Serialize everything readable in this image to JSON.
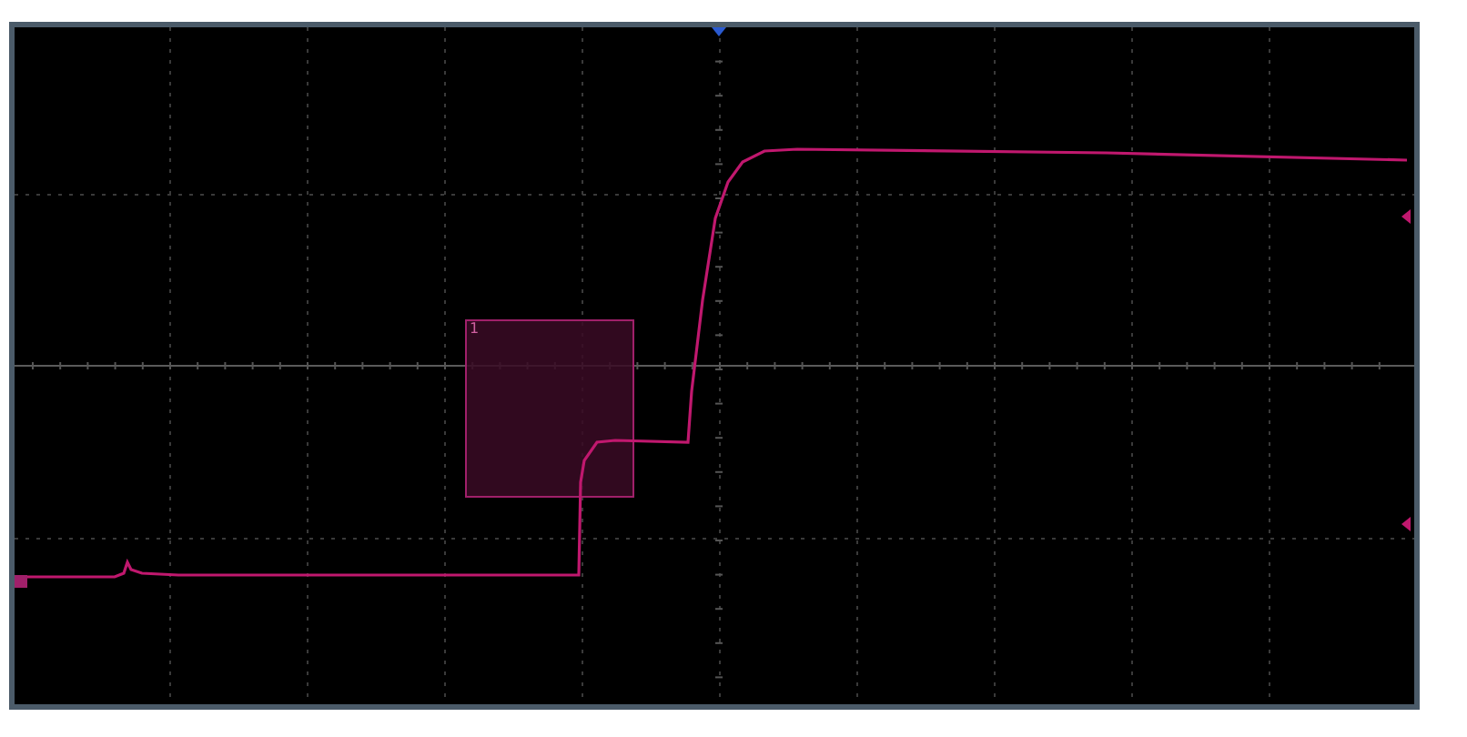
{
  "zone": {
    "label": "1"
  }
}
